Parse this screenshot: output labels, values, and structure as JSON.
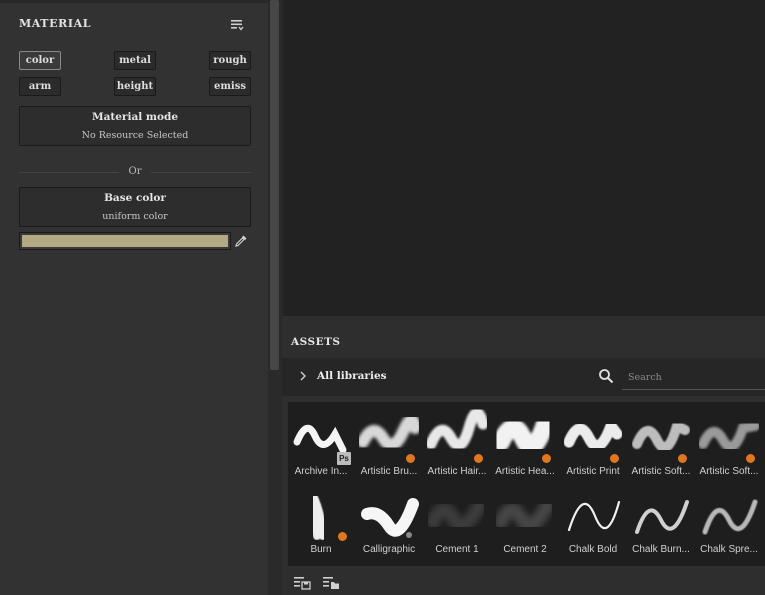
{
  "material_panel": {
    "title": "MATERIAL",
    "channels": [
      {
        "label": "color",
        "active": true
      },
      {
        "label": "metal",
        "active": false
      },
      {
        "label": "rough",
        "active": false
      },
      {
        "label": "arm",
        "active": false
      },
      {
        "label": "height",
        "active": false
      },
      {
        "label": "emiss",
        "active": false
      }
    ],
    "material_mode": {
      "title": "Material mode",
      "value": "No Resource Selected"
    },
    "or_label": "Or",
    "base_color": {
      "title": "Base color",
      "value": "uniform color",
      "swatch": "#b3a982"
    }
  },
  "assets": {
    "title": "ASSETS",
    "library_label": "All libraries",
    "search_placeholder": "Search",
    "items": [
      {
        "name": "Archive In...",
        "badge": "Ps"
      },
      {
        "name": "Artistic Bru...",
        "badge": "dot"
      },
      {
        "name": "Artistic Hair...",
        "badge": "dot"
      },
      {
        "name": "Artistic Hea...",
        "badge": "dot"
      },
      {
        "name": "Artistic Print",
        "badge": "dot"
      },
      {
        "name": "Artistic Soft...",
        "badge": "dot"
      },
      {
        "name": "Artistic Soft...",
        "badge": "dot"
      },
      {
        "name": "Burn",
        "badge": "dot"
      },
      {
        "name": "Calligraphic",
        "badge": "dots"
      },
      {
        "name": "Cement 1",
        "badge": ""
      },
      {
        "name": "Cement 2",
        "badge": ""
      },
      {
        "name": "Chalk Bold",
        "badge": ""
      },
      {
        "name": "Chalk Burn...",
        "badge": ""
      },
      {
        "name": "Chalk Spre...",
        "badge": ""
      }
    ],
    "accent": "#e0761e"
  }
}
